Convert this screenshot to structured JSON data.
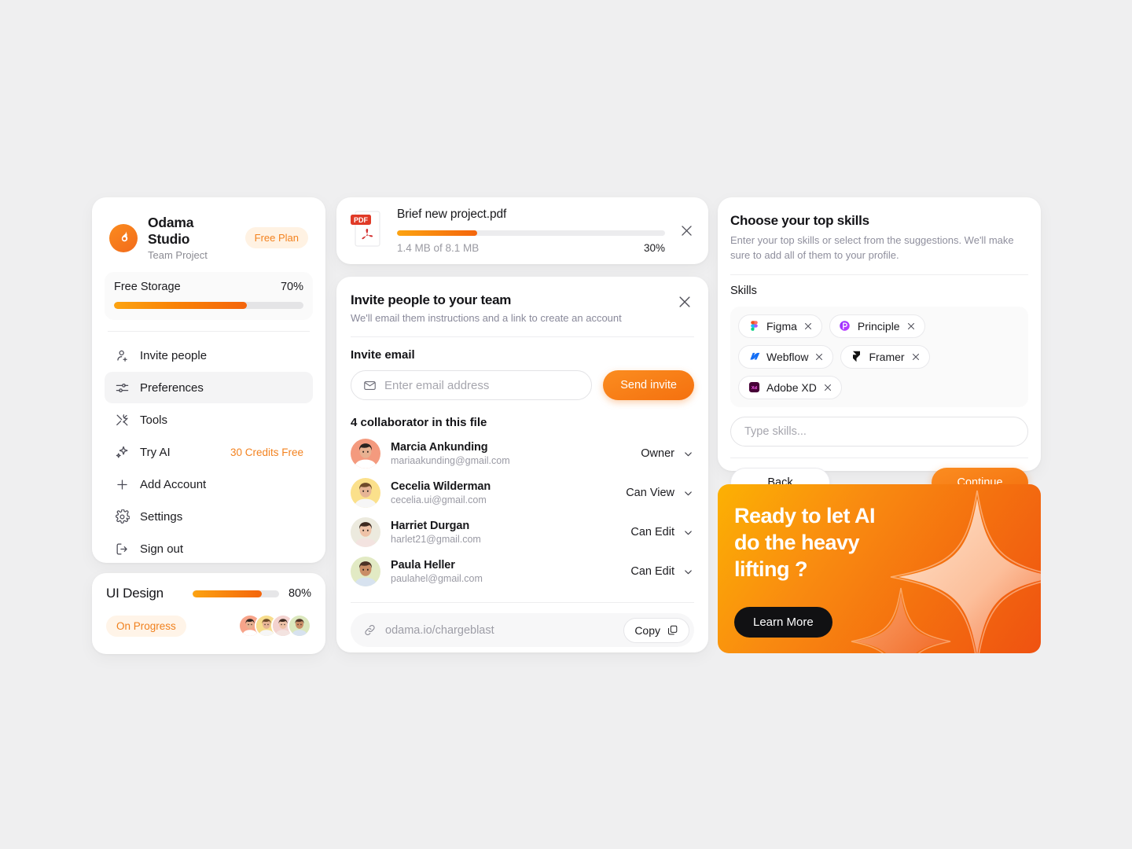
{
  "account": {
    "brand_name": "Odama Studio",
    "brand_sub": "Team Project",
    "plan_label": "Free Plan",
    "logo_icon": "flame-droplet-icon",
    "storage": {
      "label": "Free Storage",
      "percent_label": "70%",
      "percent": 70
    },
    "menu": [
      {
        "label": "Invite people",
        "icon": "user-plus-icon",
        "badge": "",
        "active": false
      },
      {
        "label": "Preferences",
        "icon": "sliders-icon",
        "badge": "",
        "active": true
      },
      {
        "label": "Tools",
        "icon": "tools-icon",
        "badge": "",
        "active": false
      },
      {
        "label": "Try AI",
        "icon": "sparkle-icon",
        "badge": "30 Credits Free",
        "active": false
      },
      {
        "label": "Add Account",
        "icon": "plus-icon",
        "badge": "",
        "active": false
      },
      {
        "label": "Settings",
        "icon": "gear-icon",
        "badge": "",
        "active": false
      },
      {
        "label": "Sign out",
        "icon": "logout-icon",
        "badge": "",
        "active": false
      }
    ]
  },
  "project": {
    "title": "UI Design",
    "percent_label": "80%",
    "percent": 80,
    "status_label": "On Progress",
    "avatars": [
      "#f7a48a",
      "#f7dd8d",
      "#f3d2cf",
      "#dbe7bd"
    ]
  },
  "upload": {
    "file_name": "Brief new project.pdf",
    "file_type_label": "PDF",
    "size_label": "1.4 MB of 8.1 MB",
    "percent_label": "30%",
    "percent": 30,
    "close_icon": "close-icon"
  },
  "invite": {
    "title": "Invite people to your team",
    "subtitle": "We'll email them instructions and a link to create an account",
    "close_icon": "close-icon",
    "field_label": "Invite email",
    "email_placeholder": "Enter email address",
    "email_value": "",
    "email_icon": "envelope-icon",
    "send_label": "Send invite",
    "collaborator_count_label": "4 collaborator in this file",
    "collaborators": [
      {
        "name": "Marcia Ankunding",
        "email": "mariaakunding@gmail.com",
        "role": "Owner",
        "avatar_bg": "#f49a7e"
      },
      {
        "name": "Cecelia Wilderman",
        "email": "cecelia.ui@gmail.com",
        "role": "Can View",
        "avatar_bg": "#fbe08b"
      },
      {
        "name": "Harriet Durgan",
        "email": "harlet21@gmail.com",
        "role": "Can Edit",
        "avatar_bg": "#eceade"
      },
      {
        "name": "Paula Heller",
        "email": "paulahel@gmail.com",
        "role": "Can Edit",
        "avatar_bg": "#e2eac4"
      }
    ],
    "link_url": "odama.io/chargeblast",
    "link_icon": "link-icon",
    "copy_label": "Copy",
    "copy_icon": "copy-icon"
  },
  "skills": {
    "title": "Choose your top skills",
    "subtitle": "Enter your top skills or select from the suggestions. We'll make sure to add all of them to your profile.",
    "label": "Skills",
    "chips": [
      {
        "name": "Figma",
        "logo": "figma-logo-icon",
        "remove_icon": "close-icon"
      },
      {
        "name": "Principle",
        "logo": "principle-logo-icon",
        "remove_icon": "close-icon"
      },
      {
        "name": "Webflow",
        "logo": "webflow-logo-icon",
        "remove_icon": "close-icon"
      },
      {
        "name": "Framer",
        "logo": "framer-logo-icon",
        "remove_icon": "close-icon"
      },
      {
        "name": "Adobe XD",
        "logo": "adobexd-logo-icon",
        "remove_icon": "close-icon"
      }
    ],
    "input_placeholder": "Type skills...",
    "input_value": "",
    "back_label": "Back",
    "continue_label": "Continue"
  },
  "ai_banner": {
    "title": "Ready to let AI\ndo the heavy\nlifting ?",
    "cta_label": "Learn More"
  },
  "theme": {
    "background": "#efeff0",
    "accent_orange": "#f4700f",
    "accent_orange_light": "#fca311",
    "text_primary": "#18181b",
    "text_muted": "#9a9aa4"
  }
}
